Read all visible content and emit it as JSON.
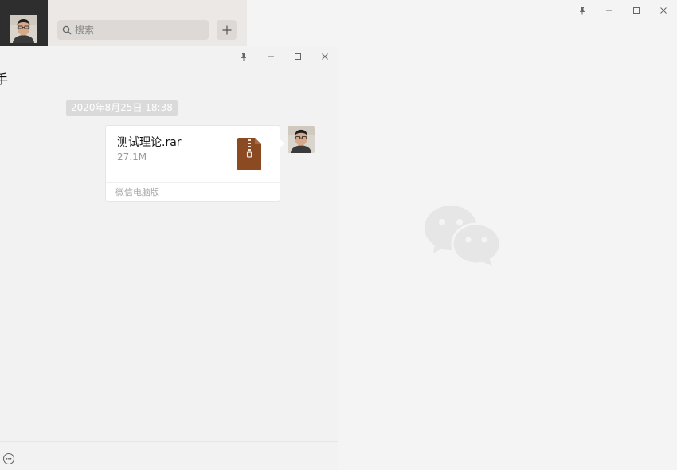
{
  "search": {
    "placeholder": "搜索"
  },
  "chat": {
    "title": "手",
    "timestamp": "2020年8月25日 18:38",
    "file_message": {
      "file_name": "测试理论.rar",
      "file_size": "27.1M",
      "source": "微信电脑版"
    }
  },
  "icons": {
    "search": "search-icon",
    "add": "plus-icon",
    "pin": "pin-icon",
    "minimize": "minimize-icon",
    "maximize": "maximize-icon",
    "close": "close-icon",
    "archive": "zip-file-icon",
    "emoji": "emoji-icon",
    "watermark": "wechat-logo"
  },
  "colors": {
    "nav_bg": "#2e2e2e",
    "search_area_bg": "#ebe8e5",
    "chat_bg": "#f2f2f2",
    "archive_icon": "#8b4a22"
  }
}
